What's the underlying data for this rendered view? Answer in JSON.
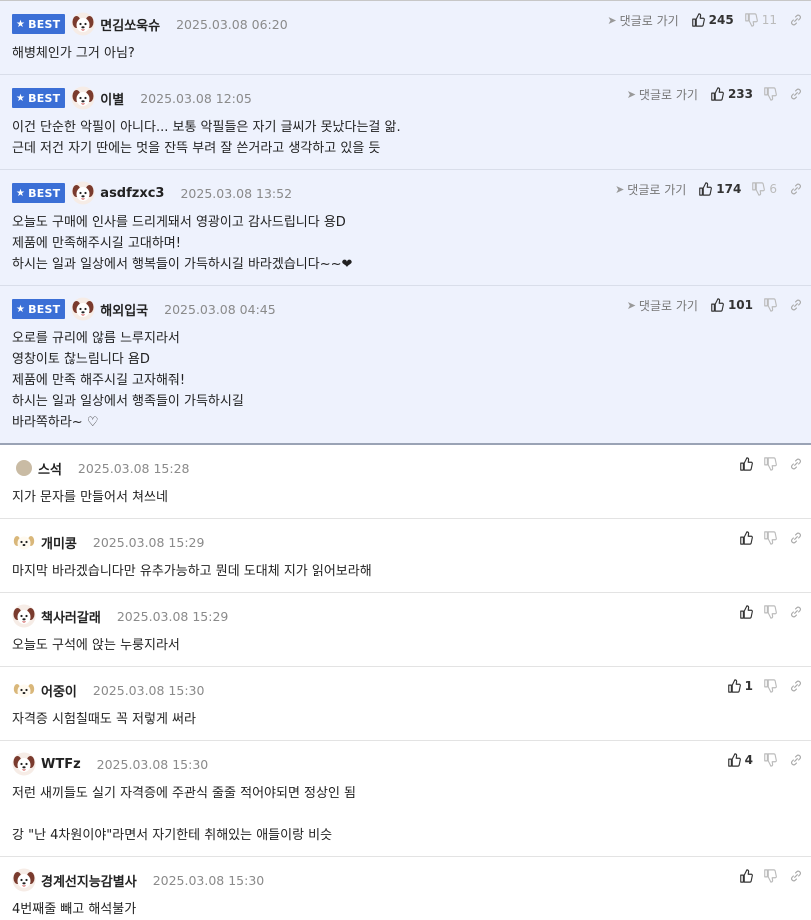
{
  "ui": {
    "best_label": "BEST",
    "goto_label": "댓글로 가기"
  },
  "comments": [
    {
      "best": true,
      "avatar": "puppy",
      "nick": "면김쏘욱슈",
      "date": "2025.03.08 06:20",
      "likes": "245",
      "dislikes": "11",
      "goto": true,
      "text": "해병체인가 그거 아님?"
    },
    {
      "best": true,
      "avatar": "puppy",
      "nick": "이별",
      "date": "2025.03.08 12:05",
      "likes": "233",
      "dislikes": "",
      "goto": true,
      "text": "이건 단순한 악필이 아니다... 보통 악필들은 자기 글씨가 못났다는걸 앎.\n근데 저건 자기 딴에는 멋을 잔뜩 부려 잘 쓴거라고 생각하고 있을 듯"
    },
    {
      "best": true,
      "avatar": "puppy",
      "nick": "asdfzxc3",
      "date": "2025.03.08 13:52",
      "likes": "174",
      "dislikes": "6",
      "goto": true,
      "text": "오늘도 구매에 인사를 드리게돼서 영광이고 감사드립니다 용D\n제품에 만족해주시길 고대하며!\n하시는 일과 일상에서 행복들이 가득하시길 바라겠습니다~~❤"
    },
    {
      "best": true,
      "avatar": "puppy",
      "nick": "해외입국",
      "date": "2025.03.08 04:45",
      "likes": "101",
      "dislikes": "",
      "goto": true,
      "text": "오로를 규리에 않름 느루지라서\n영창이토 찮느림니다 욤D\n제품에 만족 해주시길 고자해줘!\n하시는 일과 일상에서 행족들이 가득하시길\n바라쪽하라~ ♡"
    },
    {
      "best": false,
      "avatar": "dot",
      "nick": "스석",
      "date": "2025.03.08 15:28",
      "likes": "",
      "dislikes": "",
      "goto": false,
      "text": "지가 문자를 만들어서 쳐쓰네"
    },
    {
      "best": false,
      "avatar": "dog",
      "nick": "개미콩",
      "date": "2025.03.08 15:29",
      "likes": "",
      "dislikes": "",
      "goto": false,
      "text": "마지막 바라겠습니다만 유추가능하고 뭔데 도대체 지가 읽어보라해"
    },
    {
      "best": false,
      "avatar": "puppy",
      "nick": "책사러갈래",
      "date": "2025.03.08 15:29",
      "likes": "",
      "dislikes": "",
      "goto": false,
      "text": "오늘도 구석에 앉는 누룽지라서"
    },
    {
      "best": false,
      "avatar": "dog",
      "nick": "어중이",
      "date": "2025.03.08 15:30",
      "likes": "1",
      "dislikes": "",
      "goto": false,
      "text": "자격증 시험칠때도 꼭 저렇게 써라"
    },
    {
      "best": false,
      "avatar": "puppy",
      "nick": "WTFz",
      "date": "2025.03.08 15:30",
      "likes": "4",
      "dislikes": "",
      "goto": false,
      "text": "저런 새끼들도 실기 자격증에 주관식 줄줄 적어야되면 정상인 됨\n\n강 \"난 4차원이야\"라면서 자기한테 취해있는 애들이랑 비슷"
    },
    {
      "best": false,
      "avatar": "puppy",
      "nick": "경계선지능감별사",
      "date": "2025.03.08 15:30",
      "likes": "",
      "dislikes": "",
      "goto": false,
      "text": "4번째줄 빼고 해석불가"
    }
  ],
  "colors": {
    "best_bg": "#eef2fd",
    "badge": "#3b6fd6"
  }
}
